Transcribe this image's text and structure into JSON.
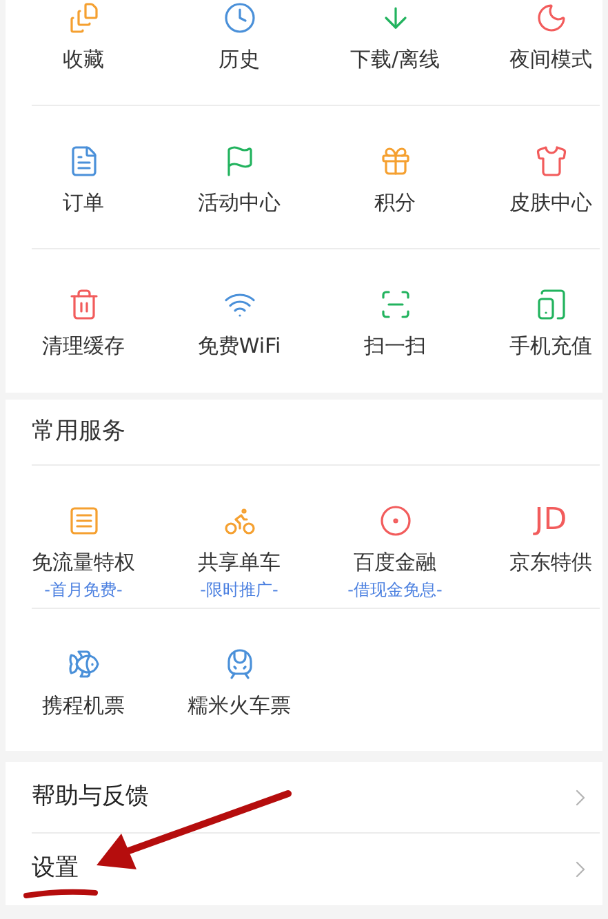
{
  "tools": [
    [
      {
        "label": "收藏",
        "color": "#f5a030"
      },
      {
        "label": "历史",
        "color": "#4a90d9"
      },
      {
        "label": "下载/离线",
        "color": "#22b35e"
      },
      {
        "label": "夜间模式",
        "color": "#f25c5c"
      }
    ],
    [
      {
        "label": "订单",
        "color": "#4a90d9"
      },
      {
        "label": "活动中心",
        "color": "#22b35e"
      },
      {
        "label": "积分",
        "color": "#f5a030"
      },
      {
        "label": "皮肤中心",
        "color": "#f25c5c"
      }
    ],
    [
      {
        "label": "清理缓存",
        "color": "#f25c5c"
      },
      {
        "label": "免费WiFi",
        "color": "#4a90d9"
      },
      {
        "label": "扫一扫",
        "color": "#22b35e"
      },
      {
        "label": "手机充值",
        "color": "#22b35e"
      }
    ]
  ],
  "services": {
    "title": "常用服务",
    "rows": [
      [
        {
          "kind": "icon",
          "label": "免流量特权",
          "color": "#f5a030",
          "note": "-首月免费-"
        },
        {
          "kind": "icon",
          "label": "共享单车",
          "color": "#f5a030",
          "note": "-限时推广-"
        },
        {
          "kind": "icon",
          "label": "百度金融",
          "color": "#f25c5c",
          "note": "-借现金免息-"
        },
        {
          "kind": "logo",
          "logo": "JD",
          "label": "京东特供",
          "color": "#f25c5c"
        }
      ],
      [
        {
          "kind": "icon",
          "label": "携程机票",
          "color": "#4a90d9"
        },
        {
          "kind": "icon",
          "label": "糯米火车票",
          "color": "#4a90d9"
        }
      ]
    ]
  },
  "menu": [
    {
      "label": "帮助与反馈"
    },
    {
      "label": "设置"
    }
  ]
}
